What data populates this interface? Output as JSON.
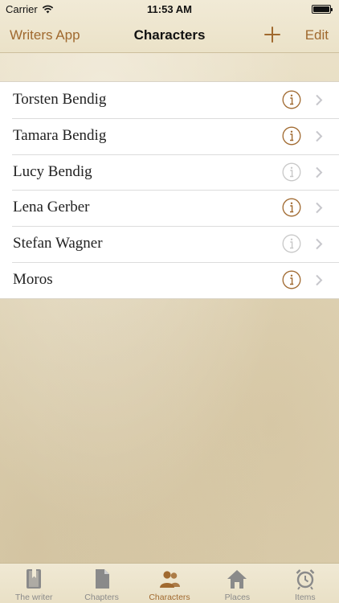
{
  "status_bar": {
    "carrier": "Carrier",
    "time": "11:53 AM"
  },
  "nav": {
    "back_label": "Writers App",
    "title": "Characters",
    "add_icon": "plus-icon",
    "edit_label": "Edit"
  },
  "characters": [
    {
      "name": "Torsten Bendig",
      "info_enabled": true
    },
    {
      "name": "Tamara Bendig",
      "info_enabled": true
    },
    {
      "name": "Lucy Bendig",
      "info_enabled": false
    },
    {
      "name": "Lena Gerber",
      "info_enabled": true
    },
    {
      "name": "Stefan Wagner",
      "info_enabled": false
    },
    {
      "name": "Moros",
      "info_enabled": true
    }
  ],
  "tabs": [
    {
      "label": "The writer",
      "icon": "bookmark-book-icon",
      "active": false
    },
    {
      "label": "Chapters",
      "icon": "document-icon",
      "active": false
    },
    {
      "label": "Characters",
      "icon": "people-icon",
      "active": true
    },
    {
      "label": "Places",
      "icon": "house-icon",
      "active": false
    },
    {
      "label": "Items",
      "icon": "alarm-clock-icon",
      "active": false
    }
  ],
  "colors": {
    "accent": "#a0692f",
    "info_disabled": "#c8c8c8",
    "tab_inactive": "#8a8a8a",
    "chevron": "#c7c7cc"
  }
}
